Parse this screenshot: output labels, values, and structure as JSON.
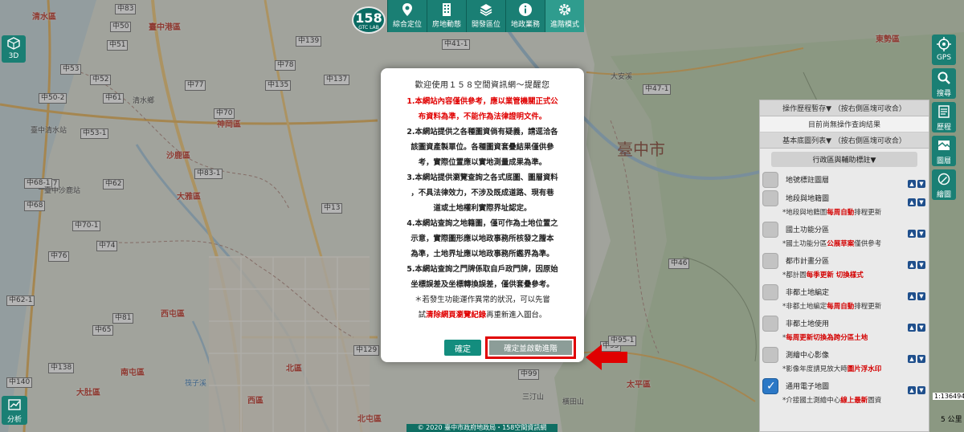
{
  "toolbar": {
    "logo_text": "158",
    "logo_sub": "GTC LAB",
    "items": [
      {
        "label": "綜合定位",
        "icon": "location-pin-icon"
      },
      {
        "label": "房地動態",
        "icon": "building-icon"
      },
      {
        "label": "開發區位",
        "icon": "layers-icon"
      },
      {
        "label": "地政業務",
        "icon": "info-icon"
      },
      {
        "label": "進階模式",
        "icon": "gear-icon"
      }
    ]
  },
  "left": {
    "btn_3d": "3D",
    "btn_analysis": "分析"
  },
  "right_bar": [
    {
      "label": "GPS",
      "icon": "gps-icon"
    },
    {
      "label": "搜尋",
      "icon": "search-icon"
    },
    {
      "label": "歷程",
      "icon": "history-icon"
    },
    {
      "label": "圖層",
      "icon": "layers-icon"
    },
    {
      "label": "繪圖",
      "icon": "draw-icon"
    }
  ],
  "panel": {
    "history_head": "操作歷程暫存▼ （按右側區塊可收合）",
    "history_empty": "目前尚無操作查詢結果",
    "base_head": "基本底圖列表▼ （按右側區塊可收合）",
    "group_title": "行政區與輔助標註▼",
    "layers": [
      {
        "name": "地號標註圖層",
        "checked": false,
        "note": null
      },
      {
        "name": "地段與地籍圖",
        "checked": false,
        "note": {
          "pre": "*地段與地籍圖",
          "hl": "每周自動",
          "hl_color": "red",
          "post": "排程更新"
        }
      },
      {
        "name": "國土功能分區",
        "checked": false,
        "note": {
          "pre": "*國土功能分區",
          "hl": "公展草案",
          "hl_color": "red",
          "post": "僅供參考"
        }
      },
      {
        "name": "都市計畫分區",
        "checked": false,
        "note": {
          "pre": "*都計圖",
          "hl": "每季更新 切換樣式",
          "hl_color": "blue",
          "post": ""
        }
      },
      {
        "name": "非都土地編定",
        "checked": false,
        "note": {
          "pre": "*非都土地編定",
          "hl": "每周自動",
          "hl_color": "red",
          "post": "排程更新"
        }
      },
      {
        "name": "非都土地使用",
        "checked": false,
        "note": {
          "pre": "*",
          "hl": "每周更新切換為跨分區土地",
          "hl_color": "red",
          "post": ""
        }
      },
      {
        "name": "測繪中心影像",
        "checked": false,
        "note": {
          "pre": "*影像年度請見放大時",
          "hl": "圖片浮水印",
          "hl_color": "red",
          "post": ""
        }
      },
      {
        "name": "通用電子地圖",
        "checked": true,
        "note": {
          "pre": "*介接國土測繪中心",
          "hl": "線上最新",
          "hl_color": "red",
          "post": "圖資"
        }
      }
    ]
  },
  "modal": {
    "title": "歡迎使用１５８空間資訊網～提醒您",
    "lines": [
      {
        "text": "1.本網站內容僅供參考，應以業管機關正式公",
        "style": "red"
      },
      {
        "text": "布資料為準，不能作為法律證明文件。",
        "style": "red"
      },
      {
        "text": "2.本網站提供之各種圖資倘有疑義，請逕洽各",
        "style": "bold"
      },
      {
        "text": "該圖資產製單位。各種圖資套疊結果僅供參",
        "style": "bold"
      },
      {
        "text": "考，實際位置應以實地測量成果為準。",
        "style": "bold"
      },
      {
        "text": "3.本網站提供瀏覽查詢之各式底圖、圖層資料",
        "style": "bold"
      },
      {
        "text": "，不具法律效力，不涉及既成道路、現有巷",
        "style": "bold"
      },
      {
        "text": "道或土地權利實際界址認定。",
        "style": "bold"
      },
      {
        "text": "4.本網站查詢之地籍圖，僅可作為土地位置之",
        "style": "bold"
      },
      {
        "text": "示意，實際圖形應以地政事務所核發之謄本",
        "style": "bold"
      },
      {
        "text": "為準，土地界址應以地政事務所鑑界為準。",
        "style": "bold"
      },
      {
        "text": "5.本網站查詢之門牌係取自戶政門牌，因原始",
        "style": "bold"
      },
      {
        "text": "坐標誤差及坐標轉換誤差，僅供套疊參考。",
        "style": "bold"
      },
      {
        "text": "＊若發生功能運作異常的狀況，可以先嘗",
        "style": "normal"
      }
    ],
    "last_line": {
      "pre": "試",
      "hl": "清除網頁瀏覽紀錄",
      "post": "再重新進入圖台。"
    },
    "ok_label": "確定",
    "advanced_label": "確定並啟動進階"
  },
  "map": {
    "city_label": "臺中市",
    "districts": [
      {
        "text": "清水區"
      },
      {
        "text": "臺中港區"
      },
      {
        "text": "清水鄉"
      },
      {
        "text": "臺中清水站"
      },
      {
        "text": "神岡區"
      },
      {
        "text": "沙鹿區"
      },
      {
        "text": "大雅區"
      },
      {
        "text": "臺中沙鹿站"
      },
      {
        "text": "西屯區"
      },
      {
        "text": "北屯區"
      },
      {
        "text": "北區"
      },
      {
        "text": "西區"
      },
      {
        "text": "南屯區"
      },
      {
        "text": "大肚區"
      },
      {
        "text": "太平區"
      },
      {
        "text": "東勢區"
      }
    ],
    "places": [
      {
        "text": "大安溪"
      },
      {
        "text": "臺中市"
      },
      {
        "text": "三汀山"
      },
      {
        "text": "橫田山"
      },
      {
        "text": "筏子溪"
      }
    ],
    "roads": [
      "中83",
      "中50",
      "中51",
      "中139",
      "中135",
      "中137",
      "中70",
      "中78",
      "中77",
      "中41-1",
      "中52",
      "中53",
      "中53-1",
      "中50-2",
      "中61",
      "中62",
      "中67",
      "中68",
      "中68-1",
      "中70-1",
      "中83-1",
      "中13",
      "中74",
      "中76",
      "中81",
      "中65",
      "中62-1",
      "中47-1",
      "中46",
      "中95",
      "中95-1",
      "中99",
      "中129",
      "中138",
      "中140"
    ],
    "footer": "© 2020 臺中市政府地政局・158空間資訊網",
    "scale_top": "1:136494",
    "scale_bottom": "5 公里"
  }
}
